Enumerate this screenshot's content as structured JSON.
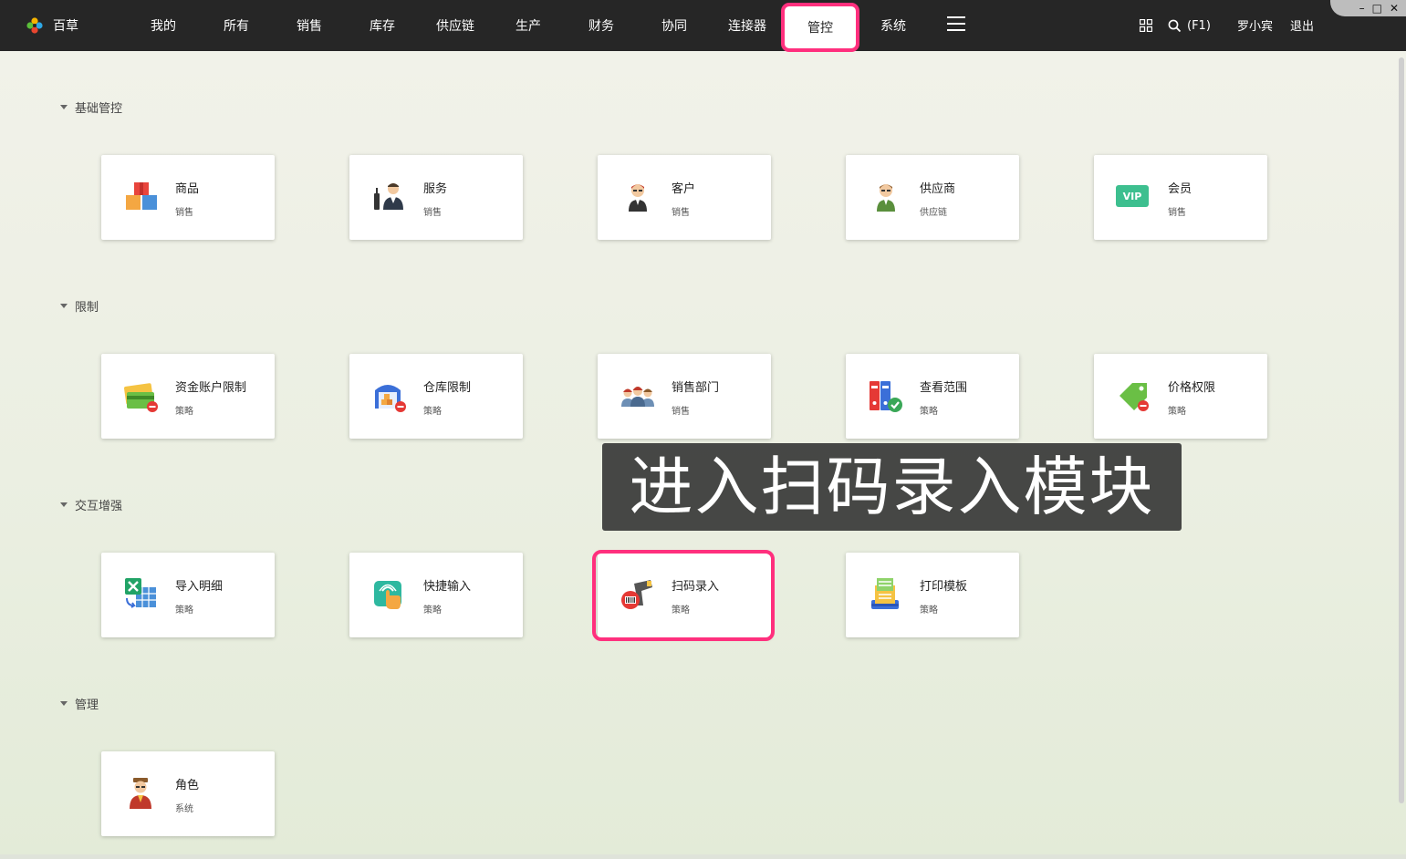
{
  "app": {
    "name": "百草",
    "logo_icon": "pinwheel-logo-icon"
  },
  "nav": {
    "items": [
      {
        "label": "我的"
      },
      {
        "label": "所有"
      },
      {
        "label": "销售"
      },
      {
        "label": "库存"
      },
      {
        "label": "供应链"
      },
      {
        "label": "生产"
      },
      {
        "label": "财务"
      },
      {
        "label": "协同"
      },
      {
        "label": "连接器"
      },
      {
        "label": "管控",
        "active": true
      },
      {
        "label": "系统"
      }
    ],
    "menu_icon": "hamburger-icon",
    "apps_icon": "grid-icon",
    "search_shortcut": "(F1)",
    "user": "罗小宾",
    "logout": "退出"
  },
  "window_controls": {
    "minimize": "–",
    "maximize": "□",
    "close": "✕"
  },
  "sections": [
    {
      "title": "基础管控",
      "cards": [
        {
          "name": "商品",
          "sub": "销售",
          "icon": "goods-boxes-icon"
        },
        {
          "name": "服务",
          "sub": "销售",
          "icon": "waiter-service-icon"
        },
        {
          "name": "客户",
          "sub": "销售",
          "icon": "customer-person-icon"
        },
        {
          "name": "供应商",
          "sub": "供应链",
          "icon": "supplier-person-icon"
        },
        {
          "name": "会员",
          "sub": "销售",
          "icon": "vip-badge-icon",
          "icon_text": "VIP"
        }
      ]
    },
    {
      "title": "限制",
      "cards": [
        {
          "name": "资金账户限制",
          "sub": "策略",
          "icon": "bank-card-restrict-icon"
        },
        {
          "name": "仓库限制",
          "sub": "策略",
          "icon": "warehouse-restrict-icon"
        },
        {
          "name": "销售部门",
          "sub": "销售",
          "icon": "team-people-icon"
        },
        {
          "name": "查看范围",
          "sub": "策略",
          "icon": "files-check-icon"
        },
        {
          "name": "价格权限",
          "sub": "策略",
          "icon": "price-tag-restrict-icon"
        }
      ]
    },
    {
      "title": "交互增强",
      "cards": [
        {
          "name": "导入明细",
          "sub": "策略",
          "icon": "excel-import-icon"
        },
        {
          "name": "快捷输入",
          "sub": "策略",
          "icon": "touch-input-icon"
        },
        {
          "name": "扫码录入",
          "sub": "策略",
          "icon": "barcode-scanner-icon",
          "highlighted": true
        },
        {
          "name": "打印模板",
          "sub": "策略",
          "icon": "printer-template-icon"
        }
      ]
    },
    {
      "title": "管理",
      "cards": [
        {
          "name": "角色",
          "sub": "系统",
          "icon": "role-person-icon"
        }
      ]
    }
  ],
  "caption": "进入扫码录入模块",
  "colors": {
    "topbar": "#262626",
    "highlight": "#ff2f7d",
    "vip_green": "#3dbf8f"
  }
}
